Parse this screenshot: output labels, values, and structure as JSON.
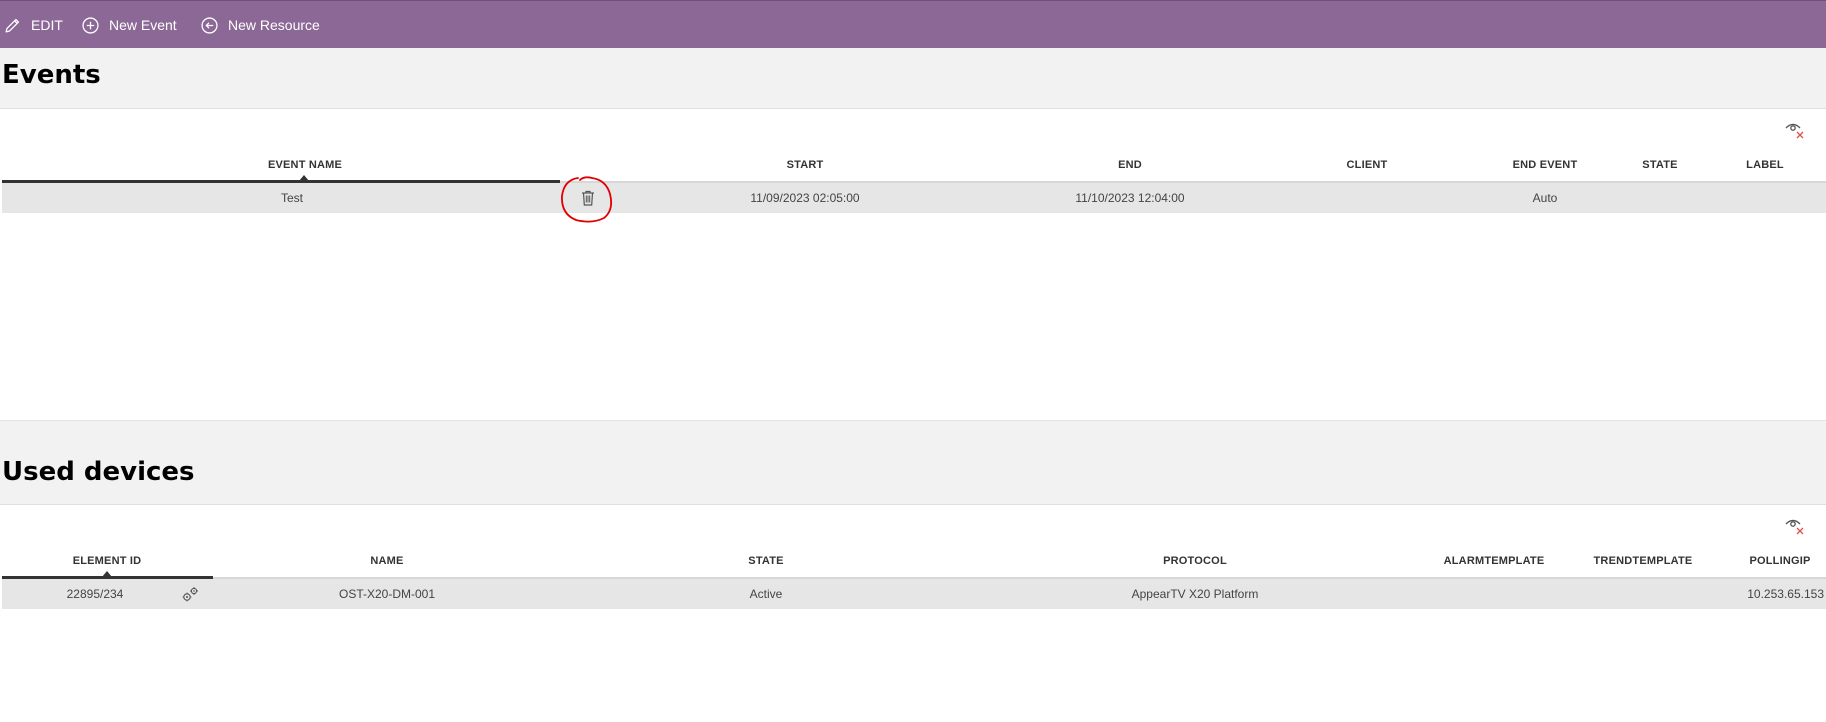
{
  "toolbar": {
    "edit_label": "EDIT",
    "new_event_label": "New Event",
    "new_resource_label": "New Resource",
    "background": "#8c6897"
  },
  "events": {
    "title": "Events",
    "columns": [
      "EVENT NAME",
      "START",
      "END",
      "CLIENT",
      "END EVENT",
      "STATE",
      "LABEL"
    ],
    "rows": [
      {
        "event_name": "Test",
        "start": "11/09/2023 02:05:00",
        "end": "11/10/2023 12:04:00",
        "client": "",
        "end_event": "Auto",
        "state": "",
        "label": "",
        "action_icon": "trash-icon"
      }
    ]
  },
  "devices": {
    "title": "Used devices",
    "columns": [
      "ELEMENT ID",
      "NAME",
      "STATE",
      "PROTOCOL",
      "ALARMTEMPLATE",
      "TRENDTEMPLATE",
      "POLLINGIP"
    ],
    "rows": [
      {
        "element_id": "22895/234",
        "name": "OST-X20-DM-001",
        "state": "Active",
        "protocol": "AppearTV X20 Platform",
        "alarmtemplate": "",
        "trendtemplate": "",
        "pollingip": "10.253.65.153",
        "action_icon": "settings-icon"
      }
    ]
  },
  "icons": {
    "column_visibility": "eye-hide-icon",
    "annotation": "red-circle-highlight"
  },
  "colors": {
    "accent": "#8c6897",
    "highlight": "#e00000",
    "close_x": "#e05050"
  }
}
